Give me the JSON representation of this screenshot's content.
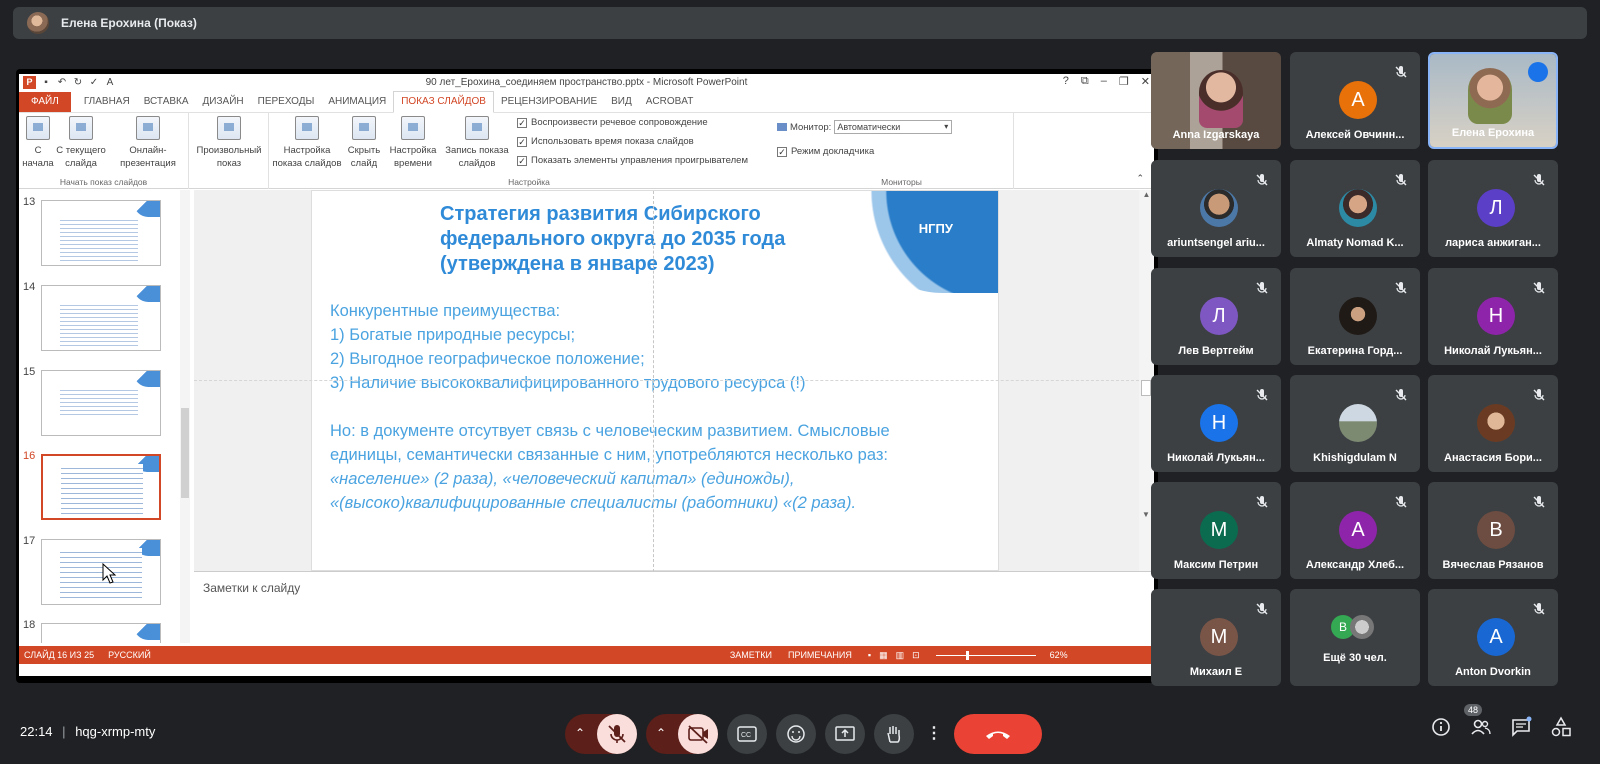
{
  "presenter": {
    "name": "Елена Ерохина (Показ)"
  },
  "powerpoint": {
    "window_title": "90 лет_Ерохина_соединяем пространство.pptx - Microsoft PowerPoint",
    "window_controls": [
      "?",
      "⧉",
      "–",
      "❐",
      "✕"
    ],
    "tabs": [
      "ФАЙЛ",
      "ГЛАВНАЯ",
      "ВСТАВКА",
      "ДИЗАЙН",
      "ПЕРЕХОДЫ",
      "АНИМАЦИЯ",
      "ПОКАЗ СЛАЙДОВ",
      "РЕЦЕНЗИРОВАНИЕ",
      "ВИД",
      "ACROBAT"
    ],
    "active_tab": "ПОКАЗ СЛАЙДОВ",
    "ribbon": {
      "start_group": {
        "name": "Начать показ слайдов",
        "buttons": [
          "С начала",
          "С текущего слайда",
          "Онлайн-презентация",
          "Произвольный показ"
        ]
      },
      "setup_group": {
        "name": "Настройка",
        "buttons": [
          "Настройка показа слайдов",
          "Скрыть слайд",
          "Настройка времени",
          "Запись показа слайдов"
        ],
        "checkboxes": [
          "Воспроизвести речевое сопровождение",
          "Использовать время показа слайдов",
          "Показать элементы управления проигрывателем"
        ]
      },
      "monitors_group": {
        "name": "Мониторы",
        "monitor_label": "Монитор:",
        "monitor_value": "Автоматически",
        "presenter_view": "Режим докладчика"
      }
    },
    "thumbnails": [
      {
        "num": "13",
        "selected": false
      },
      {
        "num": "14",
        "selected": false
      },
      {
        "num": "15",
        "selected": false
      },
      {
        "num": "16",
        "selected": true
      },
      {
        "num": "17",
        "selected": false
      },
      {
        "num": "18",
        "selected": false
      }
    ],
    "slide": {
      "logo_text": "НГПУ",
      "title_lines": [
        "Стратегия развития Сибирского",
        "федерального округа до 2035 года",
        "(утверждена в январе 2023)"
      ],
      "body_lines": [
        "Конкурентные преимущества:",
        "1)  Богатые природные ресурсы;",
        "2)  Выгодное географическое положение;",
        "3)  Наличие высококвалифицированного трудового ресурса (!)",
        "Но: в документе отсутвует связь с человеческим развитием.  Смысловые",
        "единицы, семантически связанные с ним, употребляются несколько раз:",
        "«население» (2 раза), «человеческий капитал» (единожды),",
        "«(высоко)квалифицированные специалисты (работники) «(2 раза)."
      ]
    },
    "notes_placeholder": "Заметки к слайду",
    "status": {
      "slide": "СЛАЙД 16 ИЗ 25",
      "language": "РУССКИЙ",
      "notes": "ЗАМЕТКИ",
      "comments": "ПРИМЕЧАНИЯ",
      "zoom": "62%"
    }
  },
  "participants": [
    {
      "name": "Anna Izgarskaya",
      "type": "photo",
      "muted": false
    },
    {
      "name": "Алексей Овчинн...",
      "type": "letter",
      "letter": "А",
      "color": "#e8710a",
      "muted": true
    },
    {
      "name": "Елена Ерохина",
      "type": "photo",
      "muted": false,
      "speaking": true
    },
    {
      "name": "ariuntsengel ariu...",
      "type": "photo",
      "muted": true
    },
    {
      "name": "Almaty Nomad K...",
      "type": "photo",
      "muted": true
    },
    {
      "name": "лариса анжиган...",
      "type": "letter",
      "letter": "Л",
      "color": "#5b3fc7",
      "muted": true
    },
    {
      "name": "Лев Вертгейм",
      "type": "letter",
      "letter": "Л",
      "color": "#7e57c2",
      "muted": true
    },
    {
      "name": "Екатерина Горд...",
      "type": "photo",
      "muted": true
    },
    {
      "name": "Николай Лукьян...",
      "type": "letter",
      "letter": "Н",
      "color": "#8e24aa",
      "muted": true
    },
    {
      "name": "Николай Лукьян...",
      "type": "letter",
      "letter": "Н",
      "color": "#1a73e8",
      "muted": true
    },
    {
      "name": "Khishigdulam N",
      "type": "photo",
      "muted": true
    },
    {
      "name": "Анастасия Бори...",
      "type": "photo",
      "muted": true
    },
    {
      "name": "Максим Петрин",
      "type": "letter",
      "letter": "М",
      "color": "#0b6b4f",
      "muted": true
    },
    {
      "name": "Александр Хлеб...",
      "type": "letter",
      "letter": "А",
      "color": "#8e24aa",
      "muted": true
    },
    {
      "name": "Вячеслав Рязанов",
      "type": "letter",
      "letter": "В",
      "color": "#6d4c41",
      "muted": true
    },
    {
      "name": "Михаил Е",
      "type": "letter",
      "letter": "М",
      "color": "#795548",
      "muted": true
    },
    {
      "name": "Ещё 30 чел.",
      "type": "more",
      "letter": "В",
      "color": "#34a853",
      "muted": false
    },
    {
      "name": "Anton Dvorkin",
      "type": "letter",
      "letter": "А",
      "color": "#1967d2",
      "muted": true
    }
  ],
  "meeting": {
    "time": "22:14",
    "separator": "|",
    "code": "hqg-xrmp-mty",
    "participant_count": "48"
  },
  "colors": {
    "end_call": "#ea4335",
    "accent": "#d24726",
    "slide_text": "#4aa3e0"
  }
}
